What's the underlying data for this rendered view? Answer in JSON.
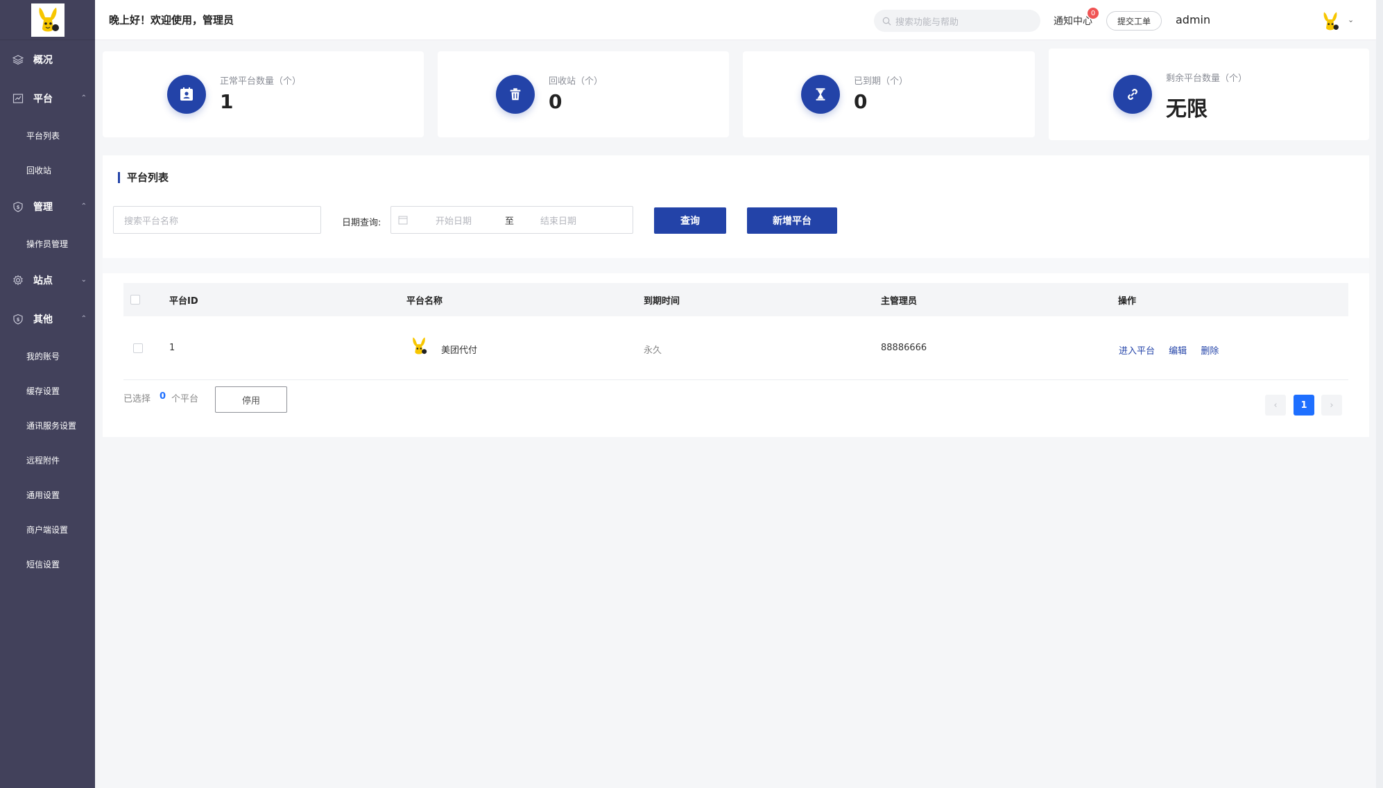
{
  "sidebar": {
    "groups": [
      {
        "label": "概况",
        "icon": "layers-icon"
      },
      {
        "label": "平台",
        "icon": "chart-icon",
        "items": [
          "平台列表",
          "回收站"
        ]
      },
      {
        "label": "管理",
        "icon": "shield-icon",
        "items": [
          "操作员管理"
        ]
      },
      {
        "label": "站点",
        "icon": "gear-icon"
      },
      {
        "label": "其他",
        "icon": "shield-icon",
        "items": [
          "我的账号",
          "缓存设置",
          "通讯服务设置",
          "远程附件",
          "通用设置",
          "商户端设置",
          "短信设置"
        ]
      }
    ]
  },
  "header": {
    "greeting": "晚上好！欢迎使用，管理员",
    "search_placeholder": "搜索功能与帮助",
    "notice_label": "通知中心",
    "notice_count": "0",
    "ticket_label": "提交工单",
    "username": "admin"
  },
  "stats": [
    {
      "label": "正常平台数量（个）",
      "value": "1",
      "icon": "calendar-user-icon"
    },
    {
      "label": "回收站（个）",
      "value": "0",
      "icon": "trash-icon"
    },
    {
      "label": "已到期（个）",
      "value": "0",
      "icon": "hourglass-icon"
    },
    {
      "label": "剩余平台数量（个）",
      "value": "无限",
      "icon": "link-icon"
    }
  ],
  "list": {
    "title": "平台列表",
    "search_placeholder": "搜索平台名称",
    "date_label": "日期查询:",
    "start_placeholder": "开始日期",
    "to_label": "至",
    "end_placeholder": "结束日期",
    "query_button": "查询",
    "add_button": "新增平台",
    "columns": [
      "平台ID",
      "平台名称",
      "到期时间",
      "主管理员",
      "操作"
    ],
    "rows": [
      {
        "id": "1",
        "name": "美团代付",
        "expire": "永久",
        "admin": "88886666",
        "actions": [
          "进入平台",
          "编辑",
          "删除"
        ]
      }
    ],
    "selected_prefix": "已选择",
    "selected_count": "0",
    "selected_suffix": "个平台",
    "disable_button": "停用",
    "current_page": "1"
  },
  "colors": {
    "primary": "#2343a8",
    "sidebar_bg": "#42415b",
    "badge": "#f05454",
    "page_active": "#1e6fff"
  }
}
